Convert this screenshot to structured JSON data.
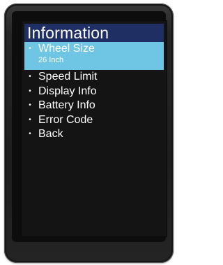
{
  "screen": {
    "title": "Information"
  },
  "menu": {
    "items": [
      {
        "label": "Wheel Size",
        "value": "26 Inch",
        "selected": true
      },
      {
        "label": "Speed Limit"
      },
      {
        "label": "Display Info"
      },
      {
        "label": "Battery Info"
      },
      {
        "label": "Error Code"
      },
      {
        "label": "Back"
      }
    ],
    "bullet": "•"
  },
  "colors": {
    "title_bar": "#1f2f63",
    "selected_row": "#6fc6e4",
    "screen_background": "#141414",
    "text": "#ffffff"
  }
}
